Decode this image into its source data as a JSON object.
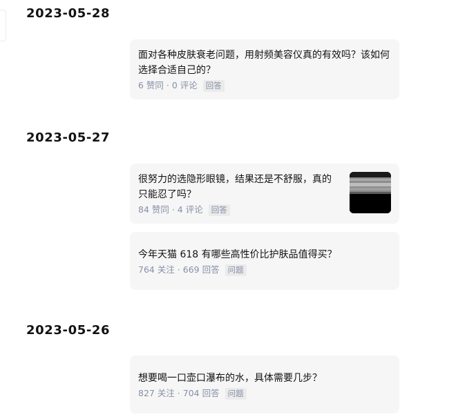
{
  "groups": [
    {
      "date": "2023-05-28",
      "items": [
        {
          "title": "面对各种皮肤衰老问题，用射频美容仪真的有效吗？该如何选择合适自己的？",
          "stats": "6 赞同 · 0 评论",
          "tag": "回答",
          "thumbnail": null
        }
      ]
    },
    {
      "date": "2023-05-27",
      "items": [
        {
          "title": "很努力的选隐形眼镜，结果还是不舒服，真的只能忍了吗？",
          "stats": "84 赞同 · 4 评论",
          "tag": "回答",
          "thumbnail": "contact-lens-photo"
        },
        {
          "title": "今年天猫 618 有哪些高性价比护肤品值得买？",
          "stats": "764 关注 · 669 回答",
          "tag": "问题",
          "thumbnail": null
        }
      ]
    },
    {
      "date": "2023-05-26",
      "items": [
        {
          "title": "想要喝一口壶口瀑布的水，具体需要几步？",
          "stats": "827 关注 · 704 回答",
          "tag": "问题",
          "thumbnail": null
        }
      ]
    }
  ],
  "colors": {
    "card_background": "#f6f6f6",
    "meta_text": "#8590a6",
    "tag_background": "#ebebeb",
    "title_text": "#121212"
  }
}
